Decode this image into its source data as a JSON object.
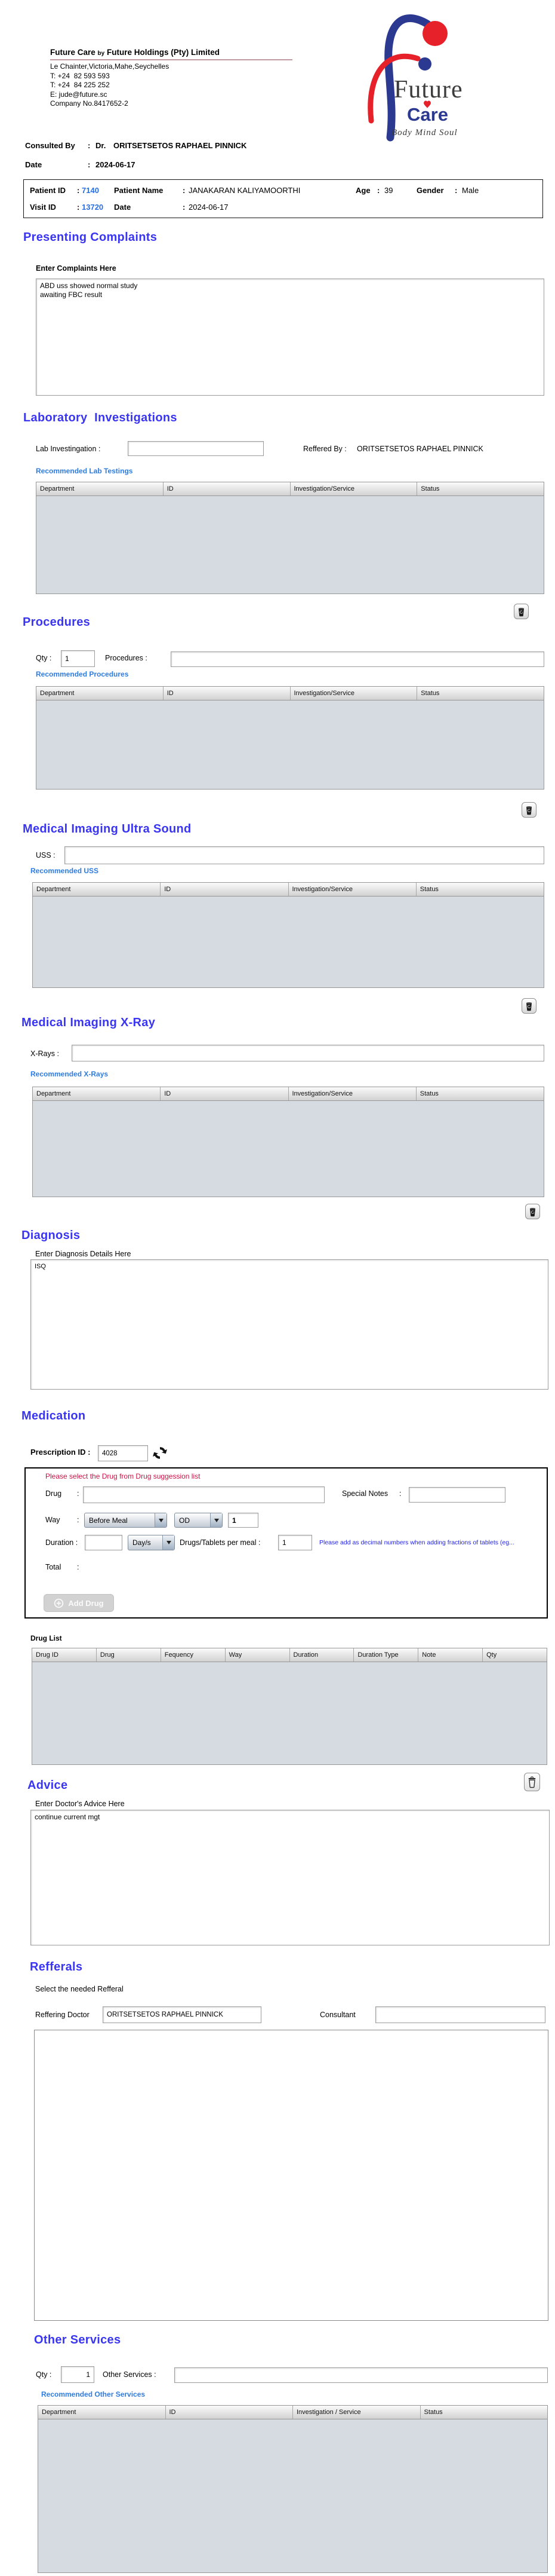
{
  "colors": {
    "heading": "#3a35f1",
    "link": "#2d7ce0",
    "id_blue": "#2a6fe0",
    "alert_red": "#cc1144",
    "note_blue": "#2222e8",
    "logo_blue": "#2b3990",
    "logo_red": "#e62129"
  },
  "header": {
    "company_name": "Future Care",
    "company_by": "by",
    "company_rest": "Future Holdings (Pty) Limited",
    "address_lines": [
      "Le Chainter,Victoria,Mahe,Seychelles",
      "T: +24  82 593 593",
      "T: +24  84 225 252",
      "E: jude@future.sc",
      "Company No.8417652-2"
    ],
    "logo": {
      "future": "Future",
      "care": "Care",
      "tagline": "Body Mind Soul"
    }
  },
  "consult": {
    "label": "Consulted By",
    "colon": ":",
    "doctor_prefix": "Dr.",
    "doctor_name": "ORITSETSETOS RAPHAEL PINNICK",
    "date_label": "Date",
    "date_value": "2024-06-17"
  },
  "patient": {
    "id_label": "Patient ID",
    "colon": ":",
    "id": "7140",
    "name_label": "Patient Name",
    "name": "JANAKARAN KALIYAMOORTHI",
    "age_label": "Age",
    "age": "39",
    "gender_label": "Gender",
    "gender": "Male",
    "visit_label": "Visit ID",
    "visit_id": "13720",
    "date_label": "Date",
    "visit_date": "2024-06-17"
  },
  "complaints": {
    "heading": "Presenting Complaints",
    "label": "Enter Complaints Here",
    "text": "ABD uss showed normal study\nawaiting FBC result"
  },
  "lab": {
    "heading": "Laboratory  Investigations",
    "input_label": "Lab Investingation :",
    "input_value": "",
    "reffered_label": "Reffered By :",
    "reffered_value": "ORITSETSETOS RAPHAEL PINNICK",
    "link": "Recommended Lab Testings",
    "headers": [
      "Department",
      "ID",
      "Investigation/Service",
      "Status"
    ]
  },
  "procedures": {
    "heading": "Procedures",
    "qty_label": "Qty :",
    "qty_value": "1",
    "input_label": "Procedures :",
    "input_value": "",
    "link": "Recommended Procedures",
    "headers": [
      "Department",
      "ID",
      "Investigation/Service",
      "Status"
    ]
  },
  "uss": {
    "heading": "Medical Imaging Ultra Sound",
    "input_label": "USS :",
    "input_value": "",
    "link": "Recommended USS",
    "headers": [
      "Department",
      "ID",
      "Investigation/Service",
      "Status"
    ]
  },
  "xray": {
    "heading": "Medical Imaging X-Ray",
    "input_label": "X-Rays :",
    "input_value": "",
    "link": "Recommended X-Rays",
    "headers": [
      "Department",
      "ID",
      "Investigation/Service",
      "Status"
    ]
  },
  "diagnosis": {
    "heading": "Diagnosis",
    "label": "Enter Diagnosis Details Here",
    "text": "ISQ"
  },
  "medication": {
    "heading": "Medication",
    "prescription_label": "Prescription ID :",
    "prescription_id": "4028",
    "alert": "Please select the Drug from Drug suggession list",
    "drug_label": "Drug",
    "colon": ":",
    "special_label": "Special Notes",
    "way_label": "Way",
    "way_value": "Before Meal",
    "frequency_value": "OD",
    "frequency_qty": "1",
    "duration_label": "Duration :",
    "duration_value": "",
    "duration_type": "Day/s",
    "per_meal_label": "Drugs/Tablets per meal :",
    "per_meal_value": "1",
    "note": "Please add as decimal numbers when adding fractions of tablets (eg...",
    "total_label": "Total",
    "add_button": "Add Drug",
    "list_label": "Drug List",
    "headers": [
      "Drug ID",
      "Drug",
      "Fequency",
      "Way",
      "Duration",
      "Duration Type",
      "Note",
      "Qty"
    ]
  },
  "advice": {
    "heading": "Advice",
    "label": "Enter Doctor's Advice Here",
    "text": "continue current mgt"
  },
  "refferals": {
    "heading": "Refferals",
    "sub_label": "Select the needed Refferal",
    "doctor_label": "Reffering Doctor",
    "doctor_value": "ORITSETSETOS RAPHAEL PINNICK",
    "consultant_label": "Consultant",
    "consultant_value": ""
  },
  "other": {
    "heading": "Other Services",
    "qty_label": "Qty :",
    "qty_value": "1",
    "input_label": "Other Services :",
    "input_value": "",
    "link": "Recommended Other Services",
    "headers": [
      "Department",
      "ID",
      "Investigation / Service",
      "Status"
    ]
  }
}
